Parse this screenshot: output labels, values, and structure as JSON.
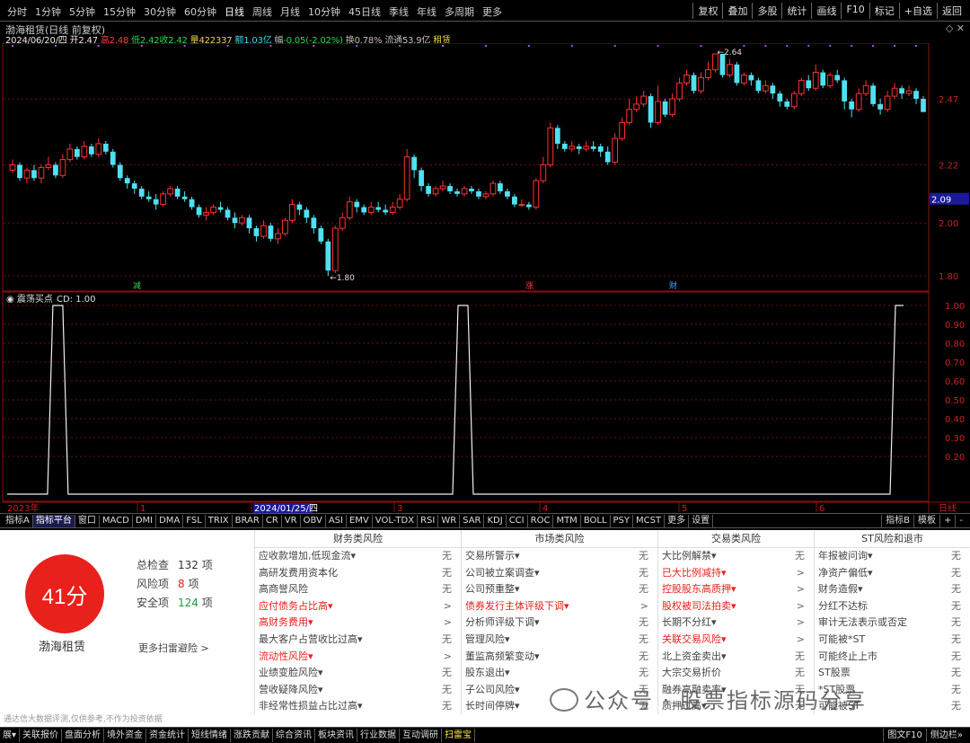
{
  "toolbar": {
    "periods": [
      "分时",
      "1分钟",
      "5分钟",
      "15分钟",
      "30分钟",
      "60分钟",
      "日线",
      "周线",
      "月线",
      "10分钟",
      "45日线",
      "季线",
      "年线",
      "多周期",
      "更多"
    ],
    "active_period": 6,
    "right_buttons": [
      "复权",
      "叠加",
      "多股",
      "统计",
      "画线",
      "F10",
      "标记",
      "+自选",
      "返回"
    ]
  },
  "stock": {
    "title": "渤海租赁(日线 前复权)",
    "date": "2024/06/20/四",
    "open_label": "开",
    "open": "2.47",
    "high_label": "高",
    "high": "2.48",
    "low_label": "低",
    "low": "2.42",
    "close_label": "收",
    "close": "2.42",
    "volume_label": "量",
    "volume": "422337",
    "amount_label": "额",
    "amount": "1.03亿",
    "change_label": "幅",
    "change": "-0.05(-2.02%)",
    "turnover_label": "换",
    "turnover": "0.78%",
    "float_label": "流通",
    "float": "53.9亿",
    "sector": "租赁"
  },
  "chart_data": [
    {
      "type": "candlestick",
      "title": "渤海租赁(日线 前复权)",
      "y_ticks": [
        "2.47",
        "2.22",
        "2.00",
        "1.80"
      ],
      "current_price_tag": "2.09",
      "high_annotation": "2.64",
      "low_annotation": "1.80",
      "event_markers": [
        "减",
        "涨",
        "财"
      ],
      "colors": {
        "up": "#ff3030",
        "down": "#50e0f0"
      },
      "candles": [
        [
          2.2,
          2.22,
          2.24,
          2.19
        ],
        [
          2.22,
          2.17,
          2.23,
          2.16
        ],
        [
          2.17,
          2.2,
          2.21,
          2.15
        ],
        [
          2.2,
          2.17,
          2.22,
          2.16
        ],
        [
          2.17,
          2.21,
          2.22,
          2.15
        ],
        [
          2.21,
          2.22,
          2.25,
          2.2
        ],
        [
          2.22,
          2.18,
          2.23,
          2.17
        ],
        [
          2.18,
          2.24,
          2.26,
          2.17
        ],
        [
          2.24,
          2.28,
          2.3,
          2.23
        ],
        [
          2.28,
          2.25,
          2.29,
          2.24
        ],
        [
          2.25,
          2.29,
          2.31,
          2.24
        ],
        [
          2.29,
          2.26,
          2.3,
          2.25
        ],
        [
          2.26,
          2.3,
          2.32,
          2.25
        ],
        [
          2.3,
          2.27,
          2.31,
          2.26
        ],
        [
          2.27,
          2.22,
          2.28,
          2.21
        ],
        [
          2.22,
          2.17,
          2.23,
          2.16
        ],
        [
          2.17,
          2.15,
          2.18,
          2.13
        ],
        [
          2.15,
          2.13,
          2.16,
          2.11
        ],
        [
          2.13,
          2.1,
          2.14,
          2.09
        ],
        [
          2.1,
          2.09,
          2.12,
          2.08
        ],
        [
          2.09,
          2.07,
          2.11,
          2.05
        ],
        [
          2.07,
          2.11,
          2.12,
          2.06
        ],
        [
          2.11,
          2.13,
          2.14,
          2.1
        ],
        [
          2.13,
          2.1,
          2.14,
          2.09
        ],
        [
          2.1,
          2.09,
          2.12,
          2.08
        ],
        [
          2.09,
          2.06,
          2.1,
          2.05
        ],
        [
          2.06,
          2.03,
          2.07,
          2.02
        ],
        [
          2.03,
          2.04,
          2.06,
          2.01
        ],
        [
          2.04,
          2.06,
          2.07,
          2.03
        ],
        [
          2.06,
          2.05,
          2.08,
          2.04
        ],
        [
          2.05,
          2.02,
          2.06,
          2.01
        ],
        [
          2.02,
          2.0,
          2.04,
          1.98
        ],
        [
          2.0,
          2.02,
          2.03,
          1.99
        ],
        [
          2.02,
          1.98,
          2.03,
          1.96
        ],
        [
          1.98,
          1.95,
          1.99,
          1.93
        ],
        [
          1.95,
          1.99,
          2.01,
          1.94
        ],
        [
          1.99,
          1.94,
          2.0,
          1.93
        ],
        [
          1.94,
          1.96,
          1.98,
          1.92
        ],
        [
          1.96,
          2.01,
          2.02,
          1.95
        ],
        [
          2.01,
          2.07,
          2.09,
          2.0
        ],
        [
          2.07,
          2.05,
          2.08,
          2.03
        ],
        [
          2.05,
          2.02,
          2.06,
          2.0
        ],
        [
          2.02,
          1.98,
          2.03,
          1.96
        ],
        [
          1.98,
          1.93,
          1.99,
          1.92
        ],
        [
          1.93,
          1.82,
          1.94,
          1.8
        ],
        [
          1.82,
          1.98,
          1.99,
          1.81
        ],
        [
          1.98,
          2.02,
          2.04,
          1.97
        ],
        [
          2.02,
          2.08,
          2.1,
          2.01
        ],
        [
          2.08,
          2.06,
          2.09,
          2.04
        ],
        [
          2.06,
          2.04,
          2.07,
          2.03
        ],
        [
          2.04,
          2.06,
          2.08,
          2.03
        ],
        [
          2.06,
          2.05,
          2.08,
          2.04
        ],
        [
          2.05,
          2.04,
          2.07,
          2.03
        ],
        [
          2.04,
          2.06,
          2.08,
          2.03
        ],
        [
          2.06,
          2.09,
          2.11,
          2.05
        ],
        [
          2.09,
          2.25,
          2.28,
          2.08
        ],
        [
          2.25,
          2.2,
          2.26,
          2.17
        ],
        [
          2.2,
          2.14,
          2.21,
          2.12
        ],
        [
          2.14,
          2.11,
          2.15,
          2.1
        ],
        [
          2.11,
          2.13,
          2.14,
          2.1
        ],
        [
          2.13,
          2.14,
          2.16,
          2.12
        ],
        [
          2.14,
          2.12,
          2.15,
          2.11
        ],
        [
          2.12,
          2.11,
          2.13,
          2.1
        ],
        [
          2.11,
          2.13,
          2.14,
          2.1
        ],
        [
          2.13,
          2.12,
          2.14,
          2.11
        ],
        [
          2.12,
          2.1,
          2.13,
          2.09
        ],
        [
          2.1,
          2.11,
          2.12,
          2.09
        ],
        [
          2.11,
          2.15,
          2.16,
          2.1
        ],
        [
          2.15,
          2.12,
          2.16,
          2.11
        ],
        [
          2.12,
          2.1,
          2.13,
          2.09
        ],
        [
          2.1,
          2.07,
          2.11,
          2.06
        ],
        [
          2.07,
          2.07,
          2.09,
          2.06
        ],
        [
          2.07,
          2.06,
          2.08,
          2.05
        ],
        [
          2.06,
          2.16,
          2.17,
          2.05
        ],
        [
          2.16,
          2.22,
          2.25,
          2.15
        ],
        [
          2.22,
          2.36,
          2.38,
          2.21
        ],
        [
          2.36,
          2.3,
          2.37,
          2.28
        ],
        [
          2.3,
          2.28,
          2.31,
          2.27
        ],
        [
          2.28,
          2.29,
          2.31,
          2.27
        ],
        [
          2.29,
          2.28,
          2.3,
          2.26
        ],
        [
          2.28,
          2.29,
          2.31,
          2.27
        ],
        [
          2.29,
          2.28,
          2.31,
          2.27
        ],
        [
          2.29,
          2.27,
          2.3,
          2.25
        ],
        [
          2.27,
          2.23,
          2.29,
          2.22
        ],
        [
          2.23,
          2.32,
          2.34,
          2.22
        ],
        [
          2.32,
          2.38,
          2.4,
          2.31
        ],
        [
          2.38,
          2.43,
          2.47,
          2.37
        ],
        [
          2.43,
          2.45,
          2.48,
          2.42
        ],
        [
          2.45,
          2.48,
          2.5,
          2.44
        ],
        [
          2.48,
          2.38,
          2.49,
          2.36
        ],
        [
          2.38,
          2.46,
          2.52,
          2.37
        ],
        [
          2.46,
          2.41,
          2.47,
          2.4
        ],
        [
          2.41,
          2.47,
          2.49,
          2.4
        ],
        [
          2.47,
          2.53,
          2.55,
          2.46
        ],
        [
          2.53,
          2.56,
          2.58,
          2.52
        ],
        [
          2.56,
          2.5,
          2.57,
          2.49
        ],
        [
          2.5,
          2.55,
          2.57,
          2.49
        ],
        [
          2.55,
          2.58,
          2.61,
          2.54
        ],
        [
          2.58,
          2.64,
          2.64,
          2.57
        ],
        [
          2.64,
          2.56,
          2.64,
          2.55
        ],
        [
          2.56,
          2.6,
          2.62,
          2.55
        ],
        [
          2.6,
          2.53,
          2.61,
          2.52
        ],
        [
          2.53,
          2.56,
          2.57,
          2.52
        ],
        [
          2.56,
          2.54,
          2.57,
          2.52
        ],
        [
          2.54,
          2.5,
          2.55,
          2.49
        ],
        [
          2.5,
          2.52,
          2.54,
          2.49
        ],
        [
          2.52,
          2.49,
          2.53,
          2.47
        ],
        [
          2.49,
          2.46,
          2.5,
          2.44
        ],
        [
          2.46,
          2.44,
          2.47,
          2.43
        ],
        [
          2.44,
          2.49,
          2.5,
          2.43
        ],
        [
          2.49,
          2.54,
          2.55,
          2.48
        ],
        [
          2.54,
          2.51,
          2.56,
          2.5
        ],
        [
          2.51,
          2.57,
          2.6,
          2.5
        ],
        [
          2.57,
          2.52,
          2.58,
          2.51
        ],
        [
          2.52,
          2.56,
          2.57,
          2.51
        ],
        [
          2.56,
          2.54,
          2.58,
          2.53
        ],
        [
          2.54,
          2.46,
          2.55,
          2.43
        ],
        [
          2.46,
          2.43,
          2.47,
          2.4
        ],
        [
          2.43,
          2.49,
          2.51,
          2.42
        ],
        [
          2.49,
          2.52,
          2.54,
          2.48
        ],
        [
          2.52,
          2.45,
          2.53,
          2.44
        ],
        [
          2.45,
          2.43,
          2.47,
          2.41
        ],
        [
          2.43,
          2.48,
          2.5,
          2.42
        ],
        [
          2.48,
          2.51,
          2.53,
          2.47
        ],
        [
          2.51,
          2.49,
          2.52,
          2.47
        ],
        [
          2.49,
          2.5,
          2.52,
          2.48
        ],
        [
          2.5,
          2.47,
          2.51,
          2.45
        ],
        [
          2.47,
          2.42,
          2.48,
          2.42
        ]
      ]
    },
    {
      "type": "line",
      "title": "震荡买点",
      "label": "CD: 1.00",
      "y_ticks": [
        "1.00",
        "0.90",
        "0.80",
        "0.70",
        "0.60",
        "0.50",
        "0.40",
        "0.30",
        "0.20"
      ],
      "x_labels": [
        "2023年",
        "1",
        "2024/01/25/四",
        "3",
        "4",
        "5",
        "6",
        "日线"
      ],
      "values": [
        0,
        0,
        0,
        0,
        0,
        1,
        1,
        1,
        0,
        0,
        0,
        0,
        0,
        0,
        0,
        0,
        0,
        0,
        0,
        0,
        0,
        0,
        0,
        0,
        0,
        0,
        0,
        0,
        0,
        0,
        0,
        0,
        0,
        0,
        0,
        0,
        0,
        0,
        0,
        0,
        0,
        0,
        0,
        0,
        0,
        0,
        0,
        0,
        0,
        0,
        0,
        0,
        0,
        0,
        0,
        0,
        0,
        0,
        0,
        0,
        0,
        0,
        0,
        0,
        0,
        0,
        0,
        0,
        0,
        0,
        0,
        0,
        0,
        0,
        0,
        0,
        0,
        0,
        0,
        0,
        0,
        0,
        0,
        0,
        0,
        0,
        0,
        0,
        0,
        0,
        0,
        0,
        0,
        0,
        0,
        0,
        0,
        0,
        0,
        0,
        0,
        0,
        0,
        0,
        0,
        0,
        0,
        0,
        0,
        0,
        0,
        0,
        0,
        0,
        0,
        0,
        0,
        0,
        0,
        0,
        0,
        0,
        0,
        0,
        0,
        0,
        0,
        0,
        0,
        0,
        0,
        0,
        1
      ],
      "pulses": [
        [
          0.045,
          0.062
        ],
        [
          0.497,
          0.514
        ],
        [
          0.985,
          1.0
        ]
      ]
    }
  ],
  "bottom_tabs": [
    "指标A",
    "指标平台",
    "窗口",
    "MACD",
    "DMI",
    "DMA",
    "FSL",
    "TRIX",
    "BRAR",
    "CR",
    "VR",
    "OBV",
    "ASI",
    "EMV",
    "VOL-TDX",
    "RSI",
    "WR",
    "SAR",
    "KDJ",
    "CCI",
    "ROC",
    "MTM",
    "BOLL",
    "PSY",
    "MCST",
    "更多",
    "设置"
  ],
  "bottom_tabs_right": [
    "指标B",
    "模板",
    "+",
    "-"
  ],
  "risk": {
    "score": "41分",
    "company": "渤海租赁",
    "stats": [
      {
        "label": "总检查",
        "value": "132",
        "unit": "项",
        "color": "#333333"
      },
      {
        "label": "风险项",
        "value": "8",
        "unit": "项",
        "color": "#e8211c"
      },
      {
        "label": "安全项",
        "value": "124",
        "unit": "项",
        "color": "#1e9a3c"
      }
    ],
    "more_scan": "更多扫雷避险 >",
    "disclaimer": "通达信大数据评测,仅供参考,不作为投资依据",
    "columns": [
      {
        "title": "财务类风险",
        "items": [
          {
            "name": "应收款增加,低现金流▾",
            "result": "无",
            "hl": false
          },
          {
            "name": "高研发费用资本化",
            "result": "无",
            "hl": false
          },
          {
            "name": "高商誉风险",
            "result": "无",
            "hl": false
          },
          {
            "name": "应付债务占比高▾",
            "result": ">",
            "hl": true
          },
          {
            "name": "高财务费用▾",
            "result": ">",
            "hl": true
          },
          {
            "name": "最大客户占营收比过高▾",
            "result": "无",
            "hl": false
          },
          {
            "name": "流动性风险▾",
            "result": ">",
            "hl": true
          },
          {
            "name": "业绩变脸风险▾",
            "result": "无",
            "hl": false
          },
          {
            "name": "营收疑降风险▾",
            "result": "无",
            "hl": false
          },
          {
            "name": "非经常性损益占比过高▾",
            "result": "无",
            "hl": false
          }
        ]
      },
      {
        "title": "市场类风险",
        "items": [
          {
            "name": "交易所警示▾",
            "result": "无",
            "hl": false
          },
          {
            "name": "公司被立案调查▾",
            "result": "无",
            "hl": false
          },
          {
            "name": "公司预重整▾",
            "result": "无",
            "hl": false
          },
          {
            "name": "债券发行主体评级下调▾",
            "result": ">",
            "hl": true
          },
          {
            "name": "分析师评级下调▾",
            "result": "无",
            "hl": false
          },
          {
            "name": "管理风险▾",
            "result": "无",
            "hl": false
          },
          {
            "name": "董监高频繁变动▾",
            "result": "无",
            "hl": false
          },
          {
            "name": "股东退出▾",
            "result": "无",
            "hl": false
          },
          {
            "name": "子公司风险▾",
            "result": "无",
            "hl": false
          },
          {
            "name": "长时间停牌▾",
            "result": "无",
            "hl": false
          }
        ]
      },
      {
        "title": "交易类风险",
        "items": [
          {
            "name": "大比例解禁▾",
            "result": "无",
            "hl": false
          },
          {
            "name": "已大比例减持▾",
            "result": ">",
            "hl": true
          },
          {
            "name": "控股股东高质押▾",
            "result": ">",
            "hl": true
          },
          {
            "name": "股权被司法拍卖▾",
            "result": ">",
            "hl": true
          },
          {
            "name": "长期不分红▾",
            "result": ">",
            "hl": false
          },
          {
            "name": "关联交易风险▾",
            "result": ">",
            "hl": true
          },
          {
            "name": "北上资金卖出▾",
            "result": "无",
            "hl": false
          },
          {
            "name": "大宗交易折价",
            "result": "无",
            "hl": false
          },
          {
            "name": "融券高融卖率▾",
            "result": "无",
            "hl": false
          },
          {
            "name": "质押过高▾",
            "result": "无",
            "hl": false
          }
        ]
      },
      {
        "title": "ST风险和退市",
        "items": [
          {
            "name": "年报被问询▾",
            "result": "无",
            "hl": false
          },
          {
            "name": "净资产偏低▾",
            "result": "无",
            "hl": false
          },
          {
            "name": "财务造假▾",
            "result": "无",
            "hl": false
          },
          {
            "name": "分红不达标",
            "result": "无",
            "hl": false
          },
          {
            "name": "审计无法表示或否定",
            "result": "无",
            "hl": false
          },
          {
            "name": "可能被*ST",
            "result": "无",
            "hl": false
          },
          {
            "name": "可能终止上市",
            "result": "无",
            "hl": false
          },
          {
            "name": "ST股票",
            "result": "无",
            "hl": false
          },
          {
            "name": "*ST股票",
            "result": "无",
            "hl": false
          },
          {
            "name": "可能被ST",
            "result": "无",
            "hl": false
          }
        ]
      }
    ],
    "watermark": "公众号 · 股票指标源码分享"
  },
  "status_tabs": [
    "展▾",
    "关联报价",
    "盘面分析",
    "境外资金",
    "资金统计",
    "短线情绪",
    "涨跌贡献",
    "综合资讯",
    "板块资讯",
    "行业数据",
    "互动调研",
    "扫雷宝"
  ],
  "status_tab_selected": 11,
  "status_right": [
    "图文F10",
    "侧边栏»"
  ]
}
